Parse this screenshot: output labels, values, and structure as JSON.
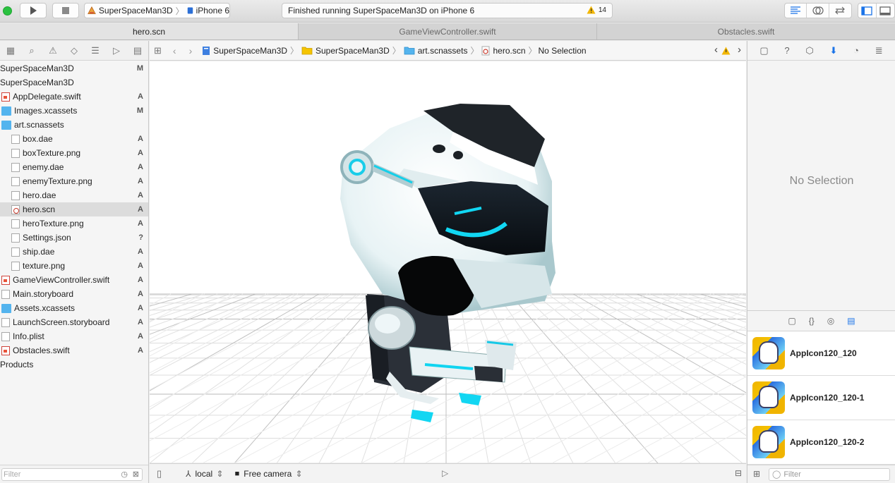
{
  "toolbar": {
    "scheme_project": "SuperSpaceMan3D",
    "scheme_device": "iPhone 6",
    "status_text": "Finished running SuperSpaceMan3D on iPhone 6",
    "warning_count": "14",
    "colors": {
      "run_green": "#2ac140",
      "warning": "#f2b600",
      "accent_blue": "#1a73e8"
    }
  },
  "tabs": [
    {
      "label": "hero.scn",
      "active": true
    },
    {
      "label": "GameViewController.swift",
      "active": false
    },
    {
      "label": "Obstacles.swift",
      "active": false
    }
  ],
  "navigator": {
    "items": [
      {
        "label": "SuperSpaceMan3D",
        "status": "M",
        "icon": "project-icon",
        "indent": 0
      },
      {
        "label": "SuperSpaceMan3D",
        "status": "",
        "icon": "folder-icon",
        "indent": 0
      },
      {
        "label": "AppDelegate.swift",
        "status": "A",
        "icon": "swift-file-icon",
        "indent": 1
      },
      {
        "label": "Images.xcassets",
        "status": "M",
        "icon": "folder-icon",
        "indent": 1
      },
      {
        "label": "art.scnassets",
        "status": "",
        "icon": "folder-icon",
        "indent": 1
      },
      {
        "label": "box.dae",
        "status": "A",
        "icon": "file-icon",
        "indent": 2
      },
      {
        "label": "boxTexture.png",
        "status": "A",
        "icon": "file-icon",
        "indent": 2
      },
      {
        "label": "enemy.dae",
        "status": "A",
        "icon": "file-icon",
        "indent": 2
      },
      {
        "label": "enemyTexture.png",
        "status": "A",
        "icon": "file-icon",
        "indent": 2
      },
      {
        "label": "hero.dae",
        "status": "A",
        "icon": "file-icon",
        "indent": 2
      },
      {
        "label": "hero.scn",
        "status": "A",
        "icon": "scene-file-icon",
        "indent": 2,
        "selected": true
      },
      {
        "label": "heroTexture.png",
        "status": "A",
        "icon": "file-icon",
        "indent": 2
      },
      {
        "label": "Settings.json",
        "status": "?",
        "icon": "file-icon",
        "indent": 2
      },
      {
        "label": "ship.dae",
        "status": "A",
        "icon": "file-icon",
        "indent": 2
      },
      {
        "label": "texture.png",
        "status": "A",
        "icon": "file-icon",
        "indent": 2
      },
      {
        "label": "GameViewController.swift",
        "status": "A",
        "icon": "swift-file-icon",
        "indent": 1
      },
      {
        "label": "Main.storyboard",
        "status": "A",
        "icon": "storyboard-icon",
        "indent": 1
      },
      {
        "label": "Assets.xcassets",
        "status": "A",
        "icon": "folder-icon",
        "indent": 1
      },
      {
        "label": "LaunchScreen.storyboard",
        "status": "A",
        "icon": "storyboard-icon",
        "indent": 1
      },
      {
        "label": "Info.plist",
        "status": "A",
        "icon": "file-icon",
        "indent": 1
      },
      {
        "label": "Obstacles.swift",
        "status": "A",
        "icon": "swift-file-icon",
        "indent": 1
      },
      {
        "label": "Products",
        "status": "",
        "icon": "folder-icon",
        "indent": 0
      }
    ],
    "filter_placeholder": "Filter"
  },
  "jumpbar": {
    "crumbs": [
      "SuperSpaceMan3D",
      "SuperSpaceMan3D",
      "art.scnassets",
      "hero.scn",
      "No Selection"
    ]
  },
  "scene_bar": {
    "coord_space": "local",
    "camera": "Free camera"
  },
  "inspector": {
    "no_selection": "No Selection",
    "library": [
      {
        "label": "AppIcon120_120"
      },
      {
        "label": "AppIcon120_120-1"
      },
      {
        "label": "AppIcon120_120-2"
      }
    ],
    "filter_placeholder": "Filter"
  }
}
